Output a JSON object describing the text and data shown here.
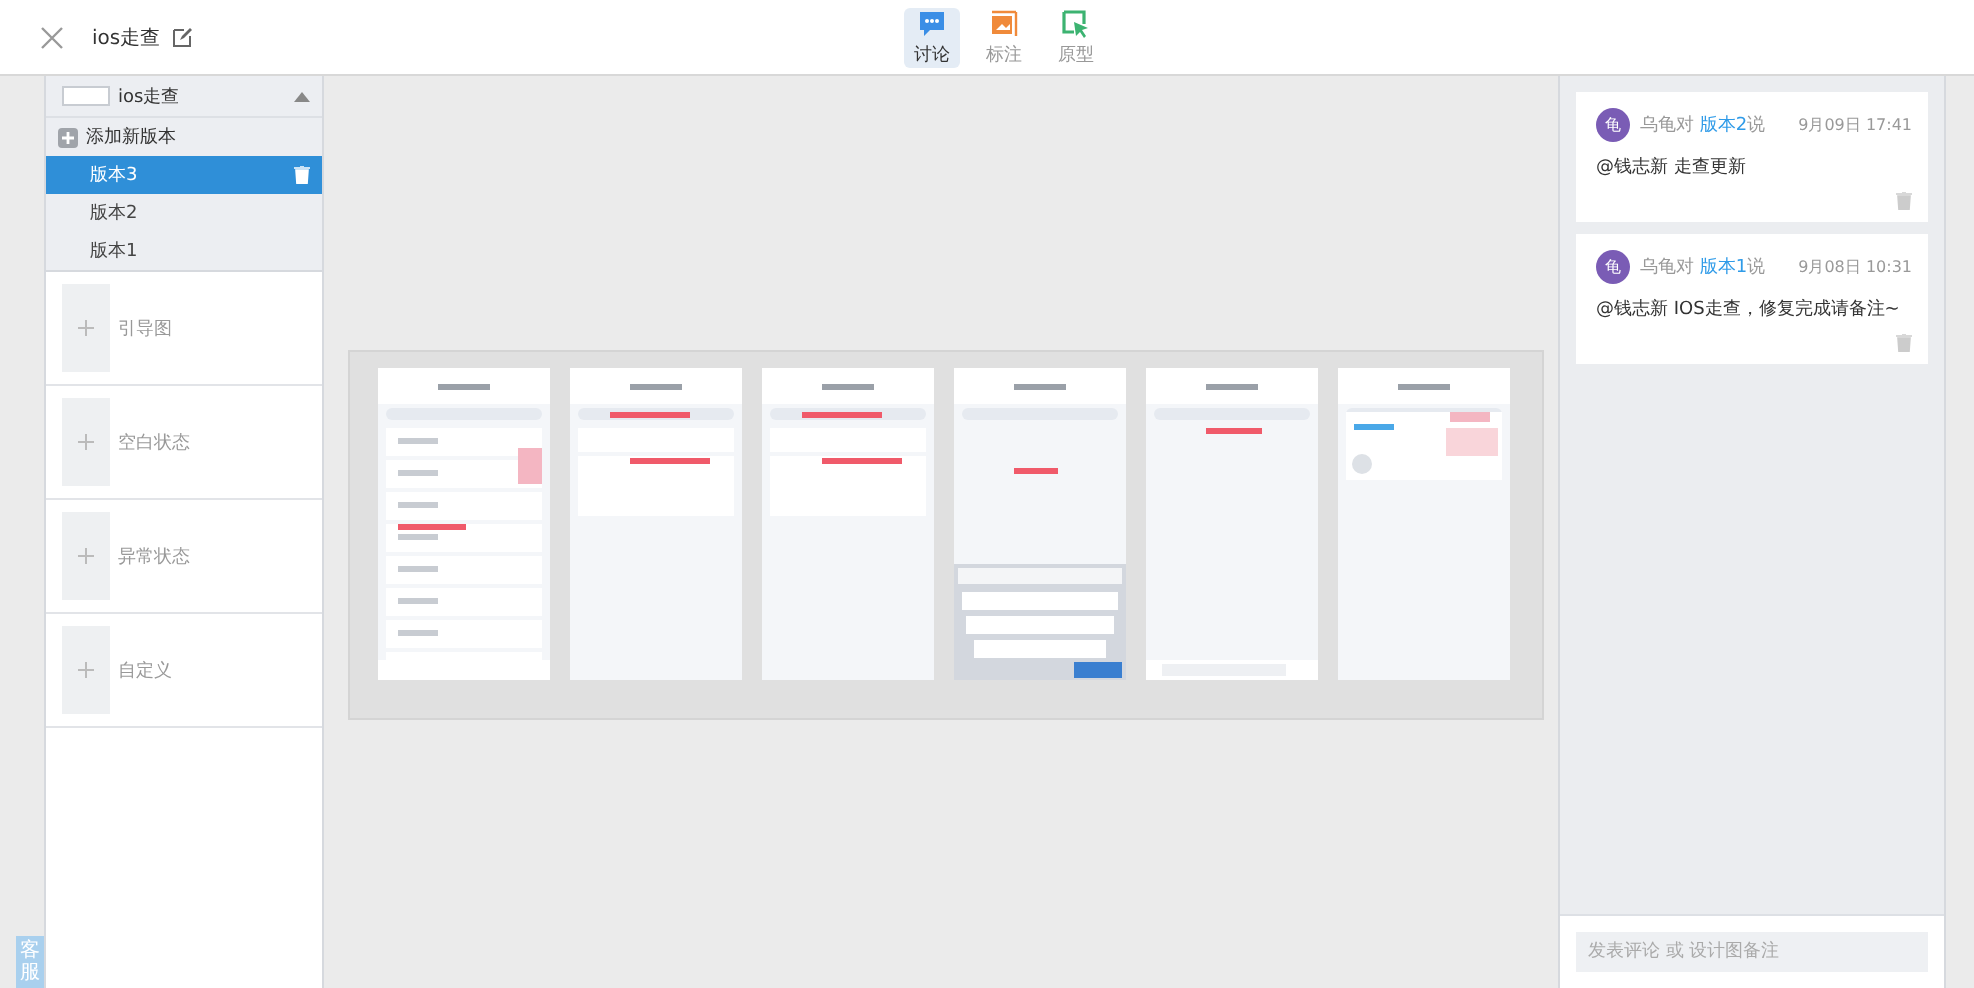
{
  "header": {
    "title": "ios走查"
  },
  "tabs": [
    {
      "kind": "discuss",
      "label": "讨论",
      "selected": true
    },
    {
      "kind": "annotate",
      "label": "标注",
      "selected": false
    },
    {
      "kind": "prototype",
      "label": "原型",
      "selected": false
    }
  ],
  "sidebar": {
    "project": "ios走查",
    "expanded": true,
    "add_label": "添加新版本",
    "versions": [
      {
        "label": "版本3",
        "selected": true
      },
      {
        "label": "版本2",
        "selected": false
      },
      {
        "label": "版本1",
        "selected": false
      }
    ],
    "sections": [
      "引导图",
      "空白状态",
      "异常状态",
      "自定义"
    ]
  },
  "canvas": {
    "screens": [
      {
        "kind": "list"
      },
      {
        "kind": "detail"
      },
      {
        "kind": "detail"
      },
      {
        "kind": "keyboard"
      },
      {
        "kind": "chat"
      },
      {
        "kind": "profile"
      }
    ]
  },
  "comments": [
    {
      "avatar": "龟",
      "author": "乌龟对",
      "version": "版本2",
      "suffix": "说",
      "time": "9月09日 17:41",
      "text": "@钱志新 走查更新"
    },
    {
      "avatar": "龟",
      "author": "乌龟对",
      "version": "版本1",
      "suffix": "说",
      "time": "9月08日 10:31",
      "text": "@钱志新 IOS走查，修复完成请备注~"
    }
  ],
  "comment_input": {
    "placeholder": "发表评论 或 设计图备注"
  },
  "support_button": "客服"
}
